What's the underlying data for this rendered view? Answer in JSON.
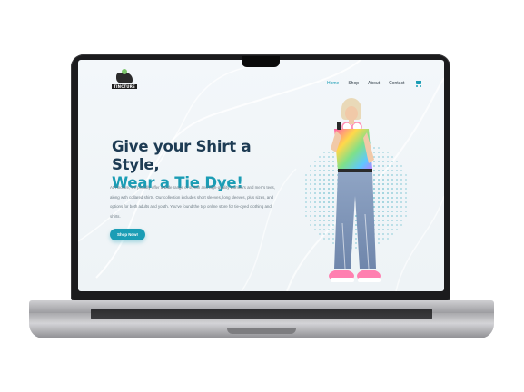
{
  "brand": {
    "logo_text": "TINCTURE"
  },
  "nav": {
    "items": [
      {
        "label": "Home",
        "active": true
      },
      {
        "label": "Shop",
        "active": false
      },
      {
        "label": "About",
        "active": false
      },
      {
        "label": "Contact",
        "active": false
      }
    ],
    "cart_icon": "shopping-cart-icon"
  },
  "hero": {
    "title_line1": "Give your Shirt a Style,",
    "title_line2": "Wear a Tie Dye!",
    "description": "At Tincture, we proudly offer a wide range of stylish and high-quality women's and men's tees, along with collared shirts. Our collection includes short sleeves, long sleeves, plus sizes, and options for both adults and youth. You've found the top online store for tie-dyed clothing and shirts.",
    "cta_label": "Shop Now!"
  },
  "colors": {
    "accent": "#1b9db5",
    "heading": "#1d3b53",
    "body_text": "#6d7a84",
    "background": "#f1f5f8"
  }
}
